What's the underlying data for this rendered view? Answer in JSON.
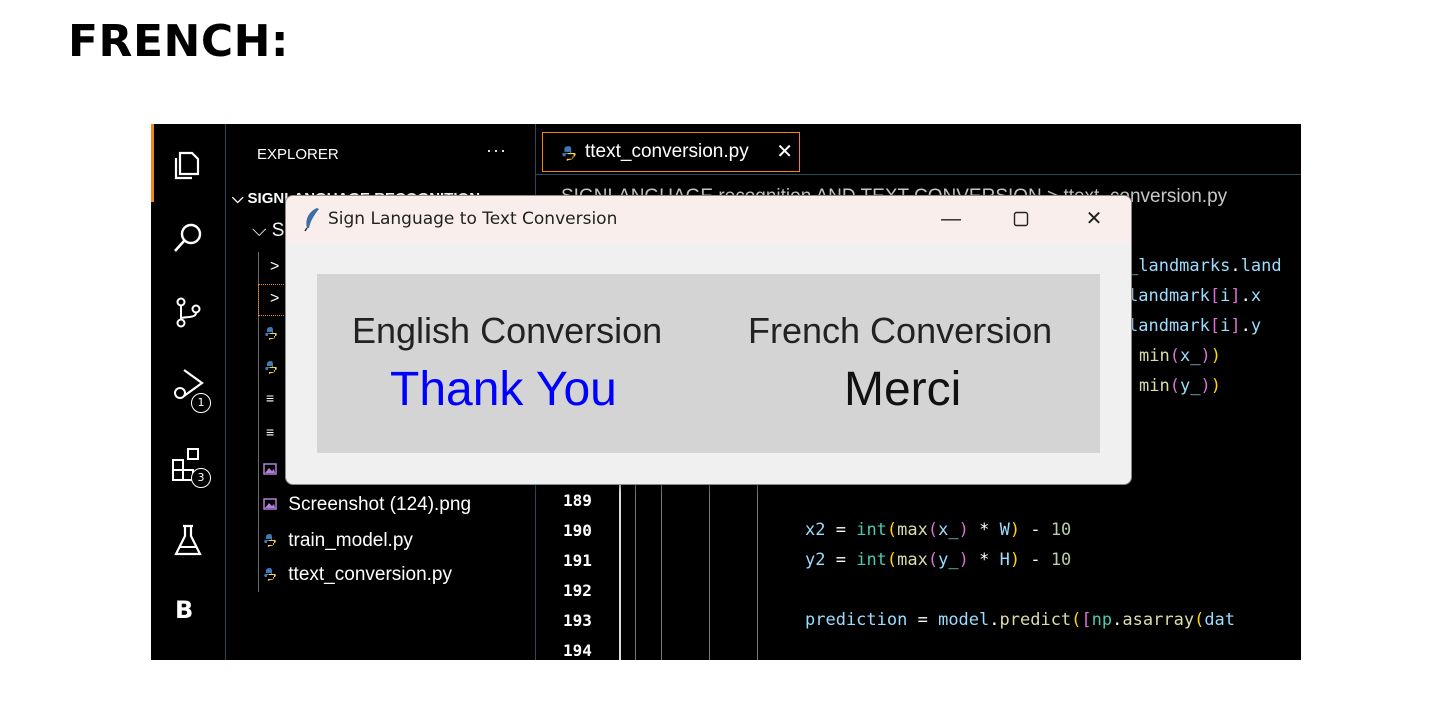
{
  "heading": "FRENCH:",
  "activity_bar": {
    "debug_badge": "1",
    "extensions_badge": "3",
    "account_letter": "B"
  },
  "explorer": {
    "title": "EXPLORER",
    "more": "···",
    "folder_name": "SIGNLANGUAGE RECOGNITION",
    "subfolder_initial": "S",
    "files": [
      "Screenshot (124).png",
      "train_model.py",
      "ttext_conversion.py"
    ]
  },
  "tab": {
    "label": "ttext_conversion.py",
    "close": "✕"
  },
  "breadcrumb": {
    "text": "SIGNLANGUAGE recognition AND TEXT CONVERSION > ",
    "file": "ttext_conversion.py"
  },
  "editor": {
    "line_numbers": [
      "189",
      "190",
      "191",
      "192",
      "193",
      "194"
    ]
  },
  "popup": {
    "title": "Sign Language to Text Conversion",
    "english_label": "English Conversion",
    "english_value": "Thank You",
    "french_label": "French Conversion",
    "french_value": "Merci",
    "english_value_color": "#0000ff",
    "french_value_color": "#111111"
  }
}
